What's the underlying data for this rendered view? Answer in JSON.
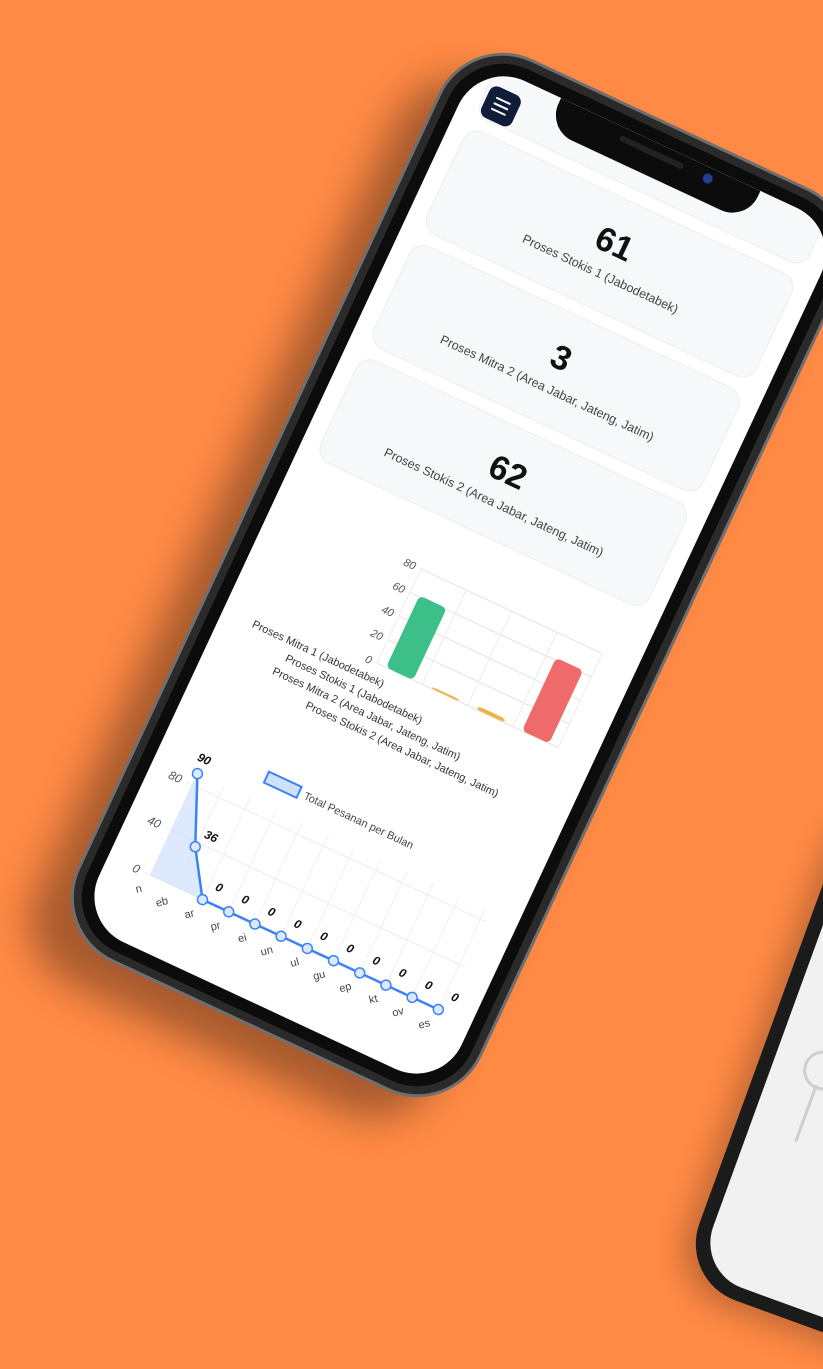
{
  "colors": {
    "background": "#ff8a45",
    "mitra1": "#3dbf8a",
    "stokis1": "#f0b34a",
    "stokis2": "#ef6b6b",
    "line": "#3b82f6",
    "line_fill": "#cfe0fb"
  },
  "icons": {
    "menu": "hamburger-menu-icon"
  },
  "cards": [
    {
      "value": "",
      "label": "Proses Mitra 1 (Jabodetabek)"
    },
    {
      "value": "61",
      "label": "Proses Stokis 1 (Jabodetabek)"
    },
    {
      "value": "3",
      "label": "Proses Mitra 2 (Area Jabar, Jateng, Jatim)"
    },
    {
      "value": "62",
      "label": "Proses Stokis 2 (Area Jabar, Jateng, Jatim)"
    }
  ],
  "chart_data": [
    {
      "type": "bar",
      "categories": [
        "Proses Mitra 1 (Jabodetabek)",
        "Proses Stokis 1 (Jabodetabek)",
        "Proses Mitra 2 (Area Jabar, Jateng, Jatim)",
        "Proses Stokis 2 (Area Jabar, Jateng, Jatim)"
      ],
      "values": [
        61,
        0,
        3,
        62
      ],
      "ylim": [
        0,
        80
      ],
      "yticks": [
        "0",
        "20",
        "40",
        "60",
        "80"
      ],
      "grid": true
    },
    {
      "type": "line",
      "categories": [
        "Jan",
        "Feb",
        "Mar",
        "Apr",
        "Mei",
        "Jun",
        "Jul",
        "Agu",
        "Sep",
        "Okt",
        "Nov",
        "Des"
      ],
      "tick_labels": [
        "n",
        "eb",
        "ar",
        "pr",
        "ei",
        "un",
        "ul",
        "gu",
        "ep",
        "kt",
        "ov",
        "es"
      ],
      "series": [
        {
          "name": "Total Pesanan per Bulan",
          "values": [
            90,
            36,
            0,
            0,
            0,
            0,
            0,
            0,
            0,
            0,
            0,
            0
          ]
        }
      ],
      "ylim": [
        0,
        90
      ],
      "yticks": [
        "0",
        "40",
        "80"
      ],
      "legend": "top",
      "grid": true
    }
  ]
}
